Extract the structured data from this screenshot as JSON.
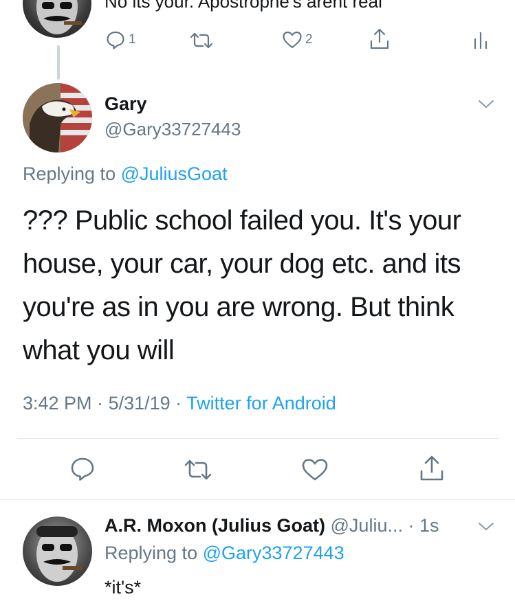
{
  "prev_tweet": {
    "text": "No its your. Apostrophe's arent real",
    "reply_count": "1",
    "like_count": "2"
  },
  "main_tweet": {
    "name": "Gary",
    "handle": "@Gary33727443",
    "replying_prefix": "Replying to ",
    "replying_to": "@JuliusGoat",
    "lines": [
      "??? Public school failed you. It's your",
      "house, your car, your dog etc. and its",
      "you're as in you are wrong. But think",
      "what you will"
    ],
    "time": "3:42 PM",
    "date": "5/31/19",
    "separator": " · ",
    "client": "Twitter for Android"
  },
  "reply_tweet": {
    "name": "A.R. Moxon (Julius Goat)",
    "handle": "@Juliu...",
    "time": "· 1s",
    "replying_prefix": "Replying to ",
    "replying_to": "@Gary33727443",
    "text": "*it's*"
  },
  "icons": {
    "reply": "reply-icon",
    "retweet": "retweet-icon",
    "like": "heart-icon",
    "share": "share-icon",
    "analytics": "analytics-icon",
    "caret": "chevron-down-icon"
  },
  "colors": {
    "link": "#1da1f2",
    "secondary": "#657786",
    "text": "#14171a",
    "divider": "#e1e8ed"
  }
}
